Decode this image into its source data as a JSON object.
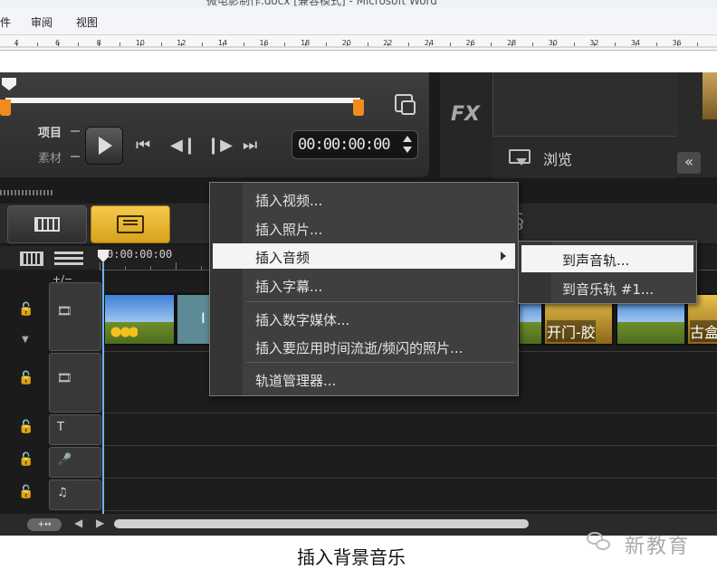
{
  "word": {
    "title": "微电影制作.docx [兼容模式] - Microsoft Word",
    "menu": [
      "件",
      "审阅",
      "视图"
    ],
    "ruler_numbers": [
      "4",
      "6",
      "8",
      "10",
      "12",
      "14",
      "16",
      "18",
      "20",
      "22",
      "24",
      "26",
      "28",
      "30",
      "32",
      "34",
      "36"
    ]
  },
  "player": {
    "mode_project": "项目",
    "mode_clip": "素材",
    "timecode": "00:00:00:00",
    "controls": [
      "home",
      "prev-frame",
      "next-frame",
      "end"
    ]
  },
  "library": {
    "fx_label": "FX",
    "browse_label": "浏览",
    "collapse_label": "«"
  },
  "timeline": {
    "ruler_time": "0:00:00:00",
    "plus_minus": "+/−",
    "clips": [
      {
        "label": "",
        "style": "sky-sunflower"
      },
      {
        "label": "I",
        "style": "teal"
      },
      {
        "label": "",
        "style": "sky"
      },
      {
        "label": "开门-胶",
        "style": "gold"
      },
      {
        "label": "",
        "style": "sky"
      },
      {
        "label": "古盒",
        "style": "gold"
      }
    ],
    "scroll_button": "+↔"
  },
  "context_menu": {
    "items": [
      "插入视频...",
      "插入照片...",
      "插入音频",
      "插入字幕...",
      "插入数字媒体...",
      "插入要应用时间流逝/频闪的照片...",
      "轨道管理器..."
    ],
    "active_index": 2,
    "submenu": [
      "到声音轨...",
      "到音乐轨 #1..."
    ]
  },
  "caption": "插入背景音乐",
  "watermark": "新教育"
}
